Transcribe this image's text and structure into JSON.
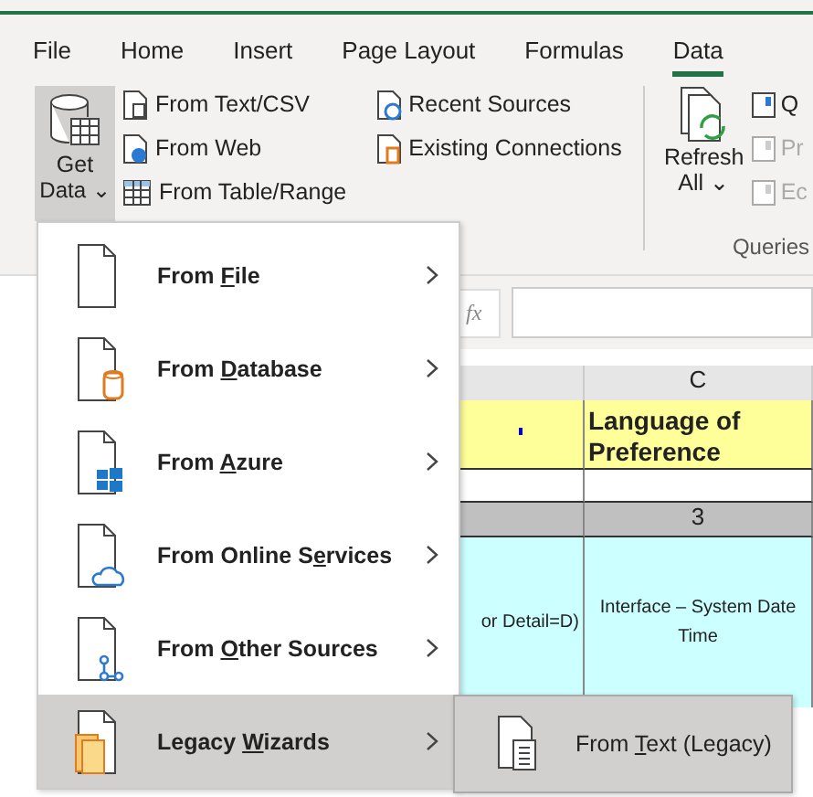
{
  "tabs": [
    {
      "label": "File",
      "selected": false
    },
    {
      "label": "Home",
      "selected": false
    },
    {
      "label": "Insert",
      "selected": false
    },
    {
      "label": "Page Layout",
      "selected": false
    },
    {
      "label": "Formulas",
      "selected": false
    },
    {
      "label": "Data",
      "selected": true
    }
  ],
  "ribbon": {
    "get_data": {
      "line1": "Get",
      "line2": "Data",
      "caret": "⌄"
    },
    "commands": [
      {
        "label": "From Text/CSV",
        "kind": "text"
      },
      {
        "label": "From Web",
        "kind": "web"
      },
      {
        "label": "From Table/Range",
        "kind": "table"
      }
    ],
    "commands_2": [
      {
        "label": "Recent Sources",
        "kind": "recent"
      },
      {
        "label": "Existing Connections",
        "kind": "connections"
      }
    ],
    "refresh": {
      "line1": "Refresh",
      "line2": "All",
      "caret": "⌄"
    },
    "queries": [
      {
        "label": "Q",
        "disabled": false
      },
      {
        "label": "Pr",
        "disabled": true
      },
      {
        "label": "Ec",
        "disabled": true
      }
    ],
    "group_label": "Queries"
  },
  "menu": {
    "items": [
      {
        "before": "From ",
        "key": "F",
        "after": "ile",
        "kind": "file",
        "selected": false
      },
      {
        "before": "From ",
        "key": "D",
        "after": "atabase",
        "kind": "database",
        "selected": false
      },
      {
        "before": "From ",
        "key": "A",
        "after": "zure",
        "kind": "azure",
        "selected": false
      },
      {
        "before": "From Online S",
        "key": "e",
        "after": "rvices",
        "kind": "cloud",
        "selected": false
      },
      {
        "before": "From ",
        "key": "O",
        "after": "ther Sources",
        "kind": "other",
        "selected": false
      },
      {
        "before": "Legacy ",
        "key": "W",
        "after": "izards",
        "kind": "legacy",
        "selected": true
      }
    ],
    "submenu": [
      {
        "before": "From ",
        "key": "T",
        "after": "ext (Legacy)"
      }
    ]
  },
  "sheet": {
    "formula_label": "fx",
    "column_header": "C",
    "header_cell": "Language of Preference",
    "row_number": "3",
    "cell_b": "or Detail=D)",
    "cell_c": "Interface – System Date Time"
  }
}
